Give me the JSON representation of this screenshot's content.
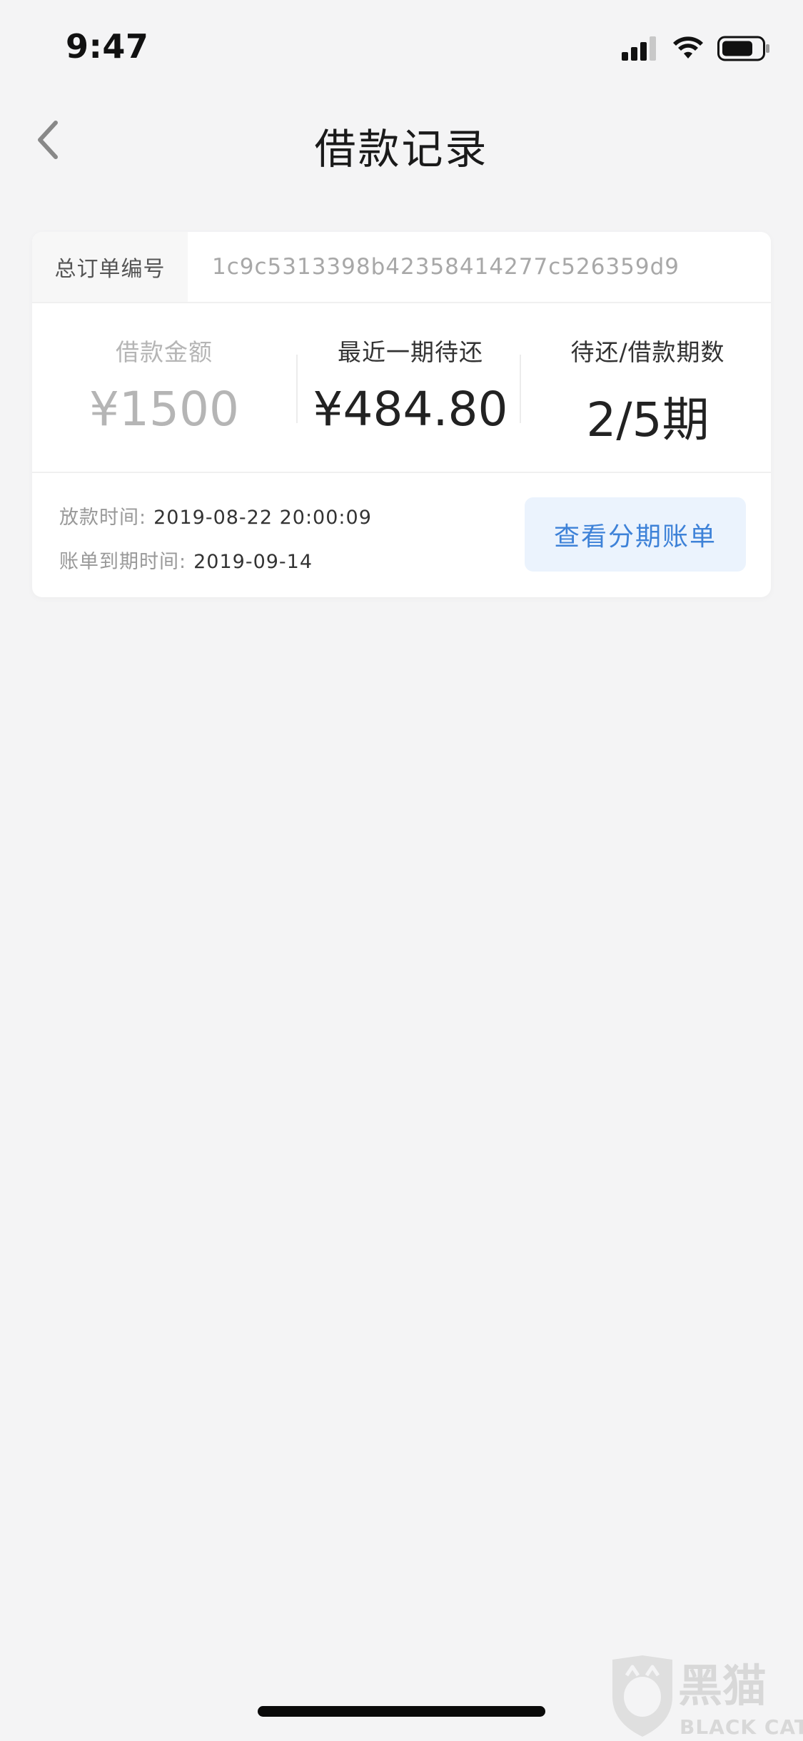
{
  "status_bar": {
    "time": "9:47",
    "icons": [
      "signal-icon",
      "wifi-icon",
      "battery-icon"
    ]
  },
  "header": {
    "back_icon": "chevron-left-icon",
    "title": "借款记录"
  },
  "card": {
    "order": {
      "label": "总订单编号",
      "value": "1c9c5313398b42358414277c526359d9"
    },
    "stats": [
      {
        "label": "借款金额",
        "value": "¥1500"
      },
      {
        "label": "最近一期待还",
        "value": "¥484.80"
      },
      {
        "label": "待还/借款期数",
        "value": "2/5期"
      }
    ],
    "disbursed": {
      "label": "放款时间:",
      "value": "2019-08-22 20:00:09"
    },
    "due": {
      "label": "账单到期时间:",
      "value": "2019-09-14"
    },
    "action_label": "查看分期账单"
  },
  "watermark": {
    "cn": "黑猫",
    "en": "BLACK CAT"
  },
  "colors": {
    "background": "#f4f4f5",
    "accent": "#3e82d8",
    "button_bg": "#ebf3fd",
    "muted_text": "#b5b5b5"
  }
}
